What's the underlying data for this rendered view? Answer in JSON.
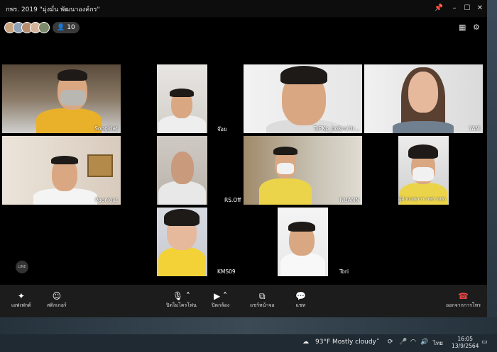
{
  "window": {
    "title": "กพร. 2019 \"มุ่งมั่น พัฒนาองค์กร\"",
    "participant_count": "10",
    "controls": {
      "pin": "📌",
      "minimize": "–",
      "maximize": "☐",
      "close": "✕"
    }
  },
  "participants": [
    {
      "name": "Songkiat"
    },
    {
      "name": "จ๊อย"
    },
    {
      "name": "TsPKp_boKm/Hr..."
    },
    {
      "name": "YAM"
    },
    {
      "name": "Poonkiat"
    },
    {
      "name": "RS.Off"
    },
    {
      "name": "NUANN"
    },
    {
      "name": "ผู้อำนวยการ กพร สปก"
    },
    {
      "name": "KMS09"
    },
    {
      "name": "Tori"
    }
  ],
  "watermark": "LINE",
  "toolbar": {
    "effects": "เอฟเฟกต์",
    "stickers": "สติกเกอร์",
    "mic": "ปิดไมโครโฟน",
    "camera": "ปิดกล้อง",
    "share": "แชร์หน้าจอ",
    "chat": "แชท",
    "leave": "ออกจากการโทร"
  },
  "taskbar": {
    "weather": "93°F  Mostly cloudy",
    "lang": "ไทย",
    "time": "16:05",
    "date": "13/9/2564"
  },
  "colors": {
    "leave": "#e64545",
    "toolbar": "#1c1c1c",
    "background": "#000000"
  }
}
